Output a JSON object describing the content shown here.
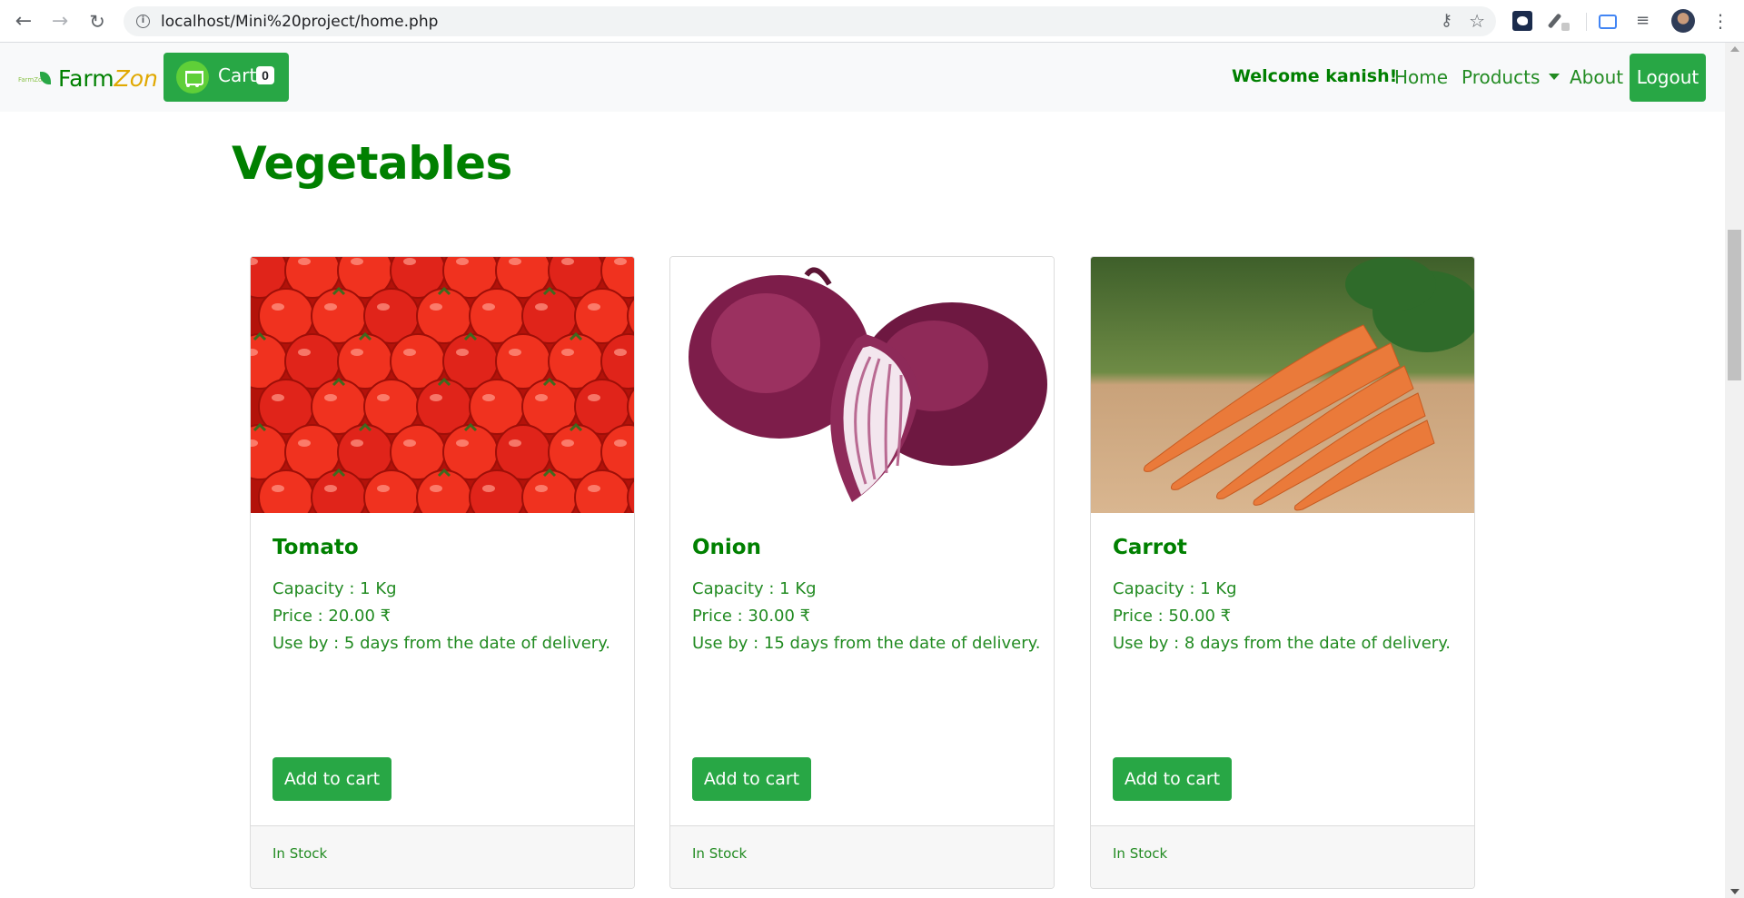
{
  "browser": {
    "url": "localhost/Mini%20project/home.php"
  },
  "navbar": {
    "brand_prefix": "Farm",
    "brand_suffix": "Zon",
    "cart_label": "Cart",
    "cart_count": "0",
    "welcome": "Welcome kanish!",
    "links": {
      "home": "Home",
      "products": "Products",
      "about": "About"
    },
    "logout": "Logout"
  },
  "main": {
    "title": "Vegetables",
    "products": [
      {
        "name": "Tomato",
        "capacity": "Capacity : 1 Kg",
        "price": "Price : 20.00 ₹",
        "use_by": "Use by : 5 days from the date of delivery.",
        "button": "Add to cart",
        "stock": "In Stock"
      },
      {
        "name": "Onion",
        "capacity": "Capacity : 1 Kg",
        "price": "Price : 30.00 ₹",
        "use_by": "Use by : 15 days from the date of delivery.",
        "button": "Add to cart",
        "stock": "In Stock"
      },
      {
        "name": "Carrot",
        "capacity": "Capacity : 1 Kg",
        "price": "Price : 50.00 ₹",
        "use_by": "Use by : 8 days from the date of delivery.",
        "button": "Add to cart",
        "stock": "In Stock"
      }
    ]
  },
  "colors": {
    "primary_green": "#28a745",
    "text_green": "#008000",
    "link_green": "#228b22",
    "brand_accent": "#e0a800",
    "navbar_bg": "#f8f9fa"
  }
}
